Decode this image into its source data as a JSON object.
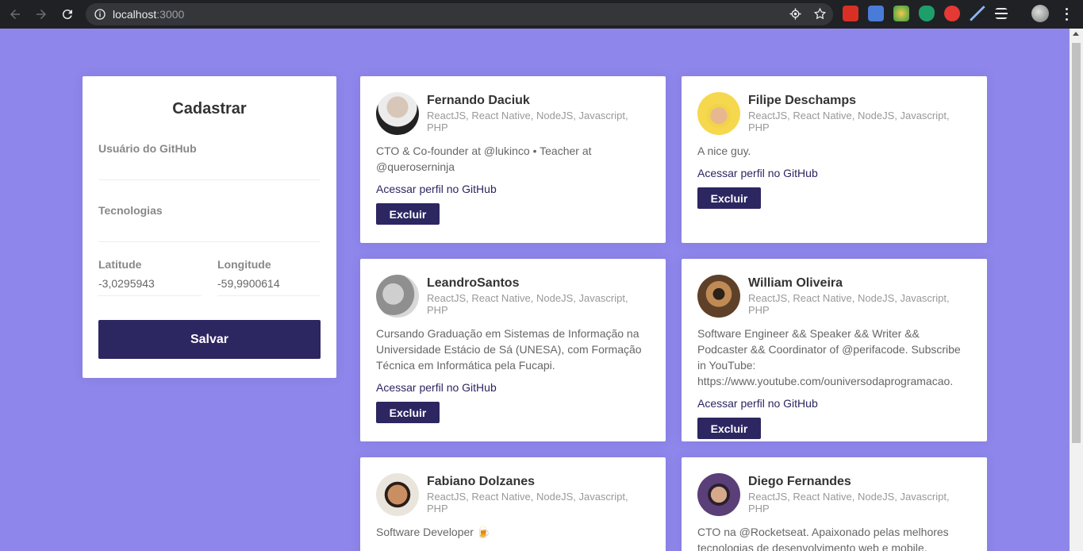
{
  "browser": {
    "url_host": "localhost",
    "url_port": ":3000"
  },
  "form": {
    "title": "Cadastrar",
    "github_label": "Usuário do GitHub",
    "github_value": "",
    "techs_label": "Tecnologias",
    "techs_value": "",
    "latitude_label": "Latitude",
    "latitude_value": "-3,0295943",
    "longitude_label": "Longitude",
    "longitude_value": "-59,9900614",
    "save_label": "Salvar"
  },
  "devs": [
    {
      "name": "Fernando Daciuk",
      "techs": "ReactJS, React Native, NodeJS, Javascript, PHP",
      "bio": "CTO & Co-founder at @lukinco • Teacher at @queroserninja",
      "link": "Acessar perfil no GitHub",
      "delete": "Excluir",
      "avatar_color": "#3a3a3a"
    },
    {
      "name": "Filipe Deschamps",
      "techs": "ReactJS, React Native, NodeJS, Javascript, PHP",
      "bio": "A nice guy.",
      "link": "Acessar perfil no GitHub",
      "delete": "Excluir",
      "avatar_color": "#f2d34a"
    },
    {
      "name": "LeandroSantos",
      "techs": "ReactJS, React Native, NodeJS, Javascript, PHP",
      "bio": "Cursando Graduação em Sistemas de Informação na Universidade Estácio de Sá (UNESA), com Formação Técnica em Informática pela Fucapi.",
      "link": "Acessar perfil no GitHub",
      "delete": "Excluir",
      "avatar_color": "#9a9a9a"
    },
    {
      "name": "William Oliveira",
      "techs": "ReactJS, React Native, NodeJS, Javascript, PHP",
      "bio": "Software Engineer && Speaker && Writer && Podcaster && Coordinator of @perifacode. Subscribe in YouTube: https://www.youtube.com/ouniversodaprogramacao.",
      "link": "Acessar perfil no GitHub",
      "delete": "Excluir",
      "avatar_color": "#7a5a3a"
    },
    {
      "name": "Fabiano Dolzanes",
      "techs": "ReactJS, React Native, NodeJS, Javascript, PHP",
      "bio": "Software Developer 🍺",
      "link": "",
      "delete": "",
      "avatar_color": "#6b4a32"
    },
    {
      "name": "Diego Fernandes",
      "techs": "ReactJS, React Native, NodeJS, Javascript, PHP",
      "bio": "CTO na @Rocketseat. Apaixonado pelas melhores tecnologias de desenvolvimento web e mobile.",
      "link": "",
      "delete": "",
      "avatar_color": "#4a3a6a"
    }
  ]
}
